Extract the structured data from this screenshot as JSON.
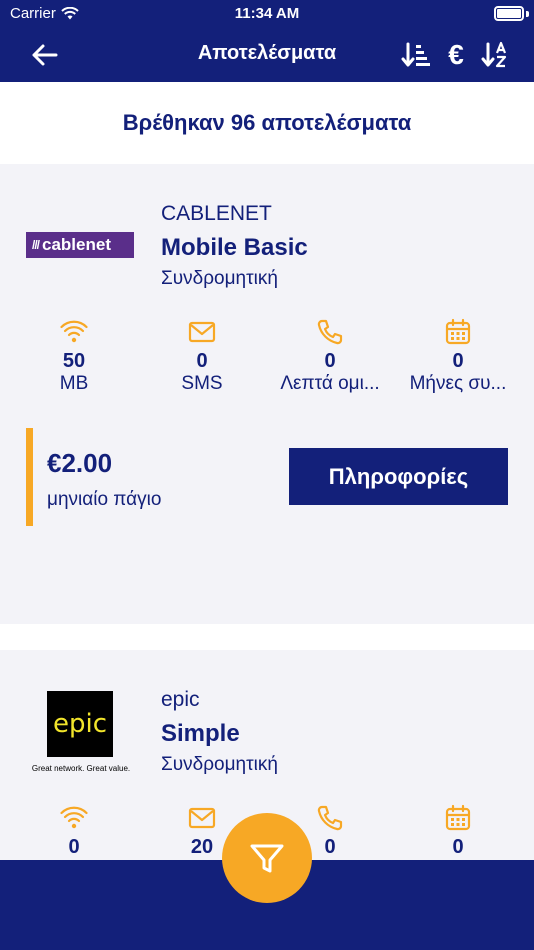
{
  "status_bar": {
    "carrier": "Carrier",
    "time": "11:34 AM"
  },
  "nav": {
    "title": "Αποτελέσματα",
    "back_icon": "arrow-left-icon",
    "actions": [
      {
        "icon": "sort-by-rank-icon"
      },
      {
        "icon": "euro-icon",
        "label": "€"
      },
      {
        "icon": "sort-alphabetical-icon"
      }
    ]
  },
  "results": {
    "summary": "Βρέθηκαν 96 αποτελέσματα"
  },
  "plans": [
    {
      "logo_text": "cablenet",
      "provider": "CABLENET",
      "plan_name": "Mobile Basic",
      "plan_type": "Συνδρομητική",
      "features": [
        {
          "icon": "wifi-icon",
          "value": "50",
          "label": "MB"
        },
        {
          "icon": "envelope-icon",
          "value": "0",
          "label": "SMS"
        },
        {
          "icon": "phone-icon",
          "value": "0",
          "label": "Λεπτά ομι..."
        },
        {
          "icon": "calendar-icon",
          "value": "0",
          "label": "Μήνες συ..."
        }
      ],
      "price": "€2.00",
      "price_label": "μηνιαίο πάγιο",
      "info_button": "Πληροφορίες"
    },
    {
      "logo_text": "epic",
      "logo_tagline": "Great network. Great value.",
      "provider": "epic",
      "plan_name": "Simple",
      "plan_type": "Συνδρομητική",
      "features": [
        {
          "icon": "wifi-icon",
          "value": "0"
        },
        {
          "icon": "envelope-icon",
          "value": "20"
        },
        {
          "icon": "phone-icon",
          "value": "0"
        },
        {
          "icon": "calendar-icon",
          "value": "0"
        }
      ]
    }
  ],
  "fab": {
    "icon": "filter-icon"
  },
  "colors": {
    "primary": "#13207a",
    "accent": "#f7a825",
    "card_bg": "#f3f3f8",
    "cablenet_purple": "#5a2e8a",
    "epic_yellow": "#f2e52b"
  }
}
